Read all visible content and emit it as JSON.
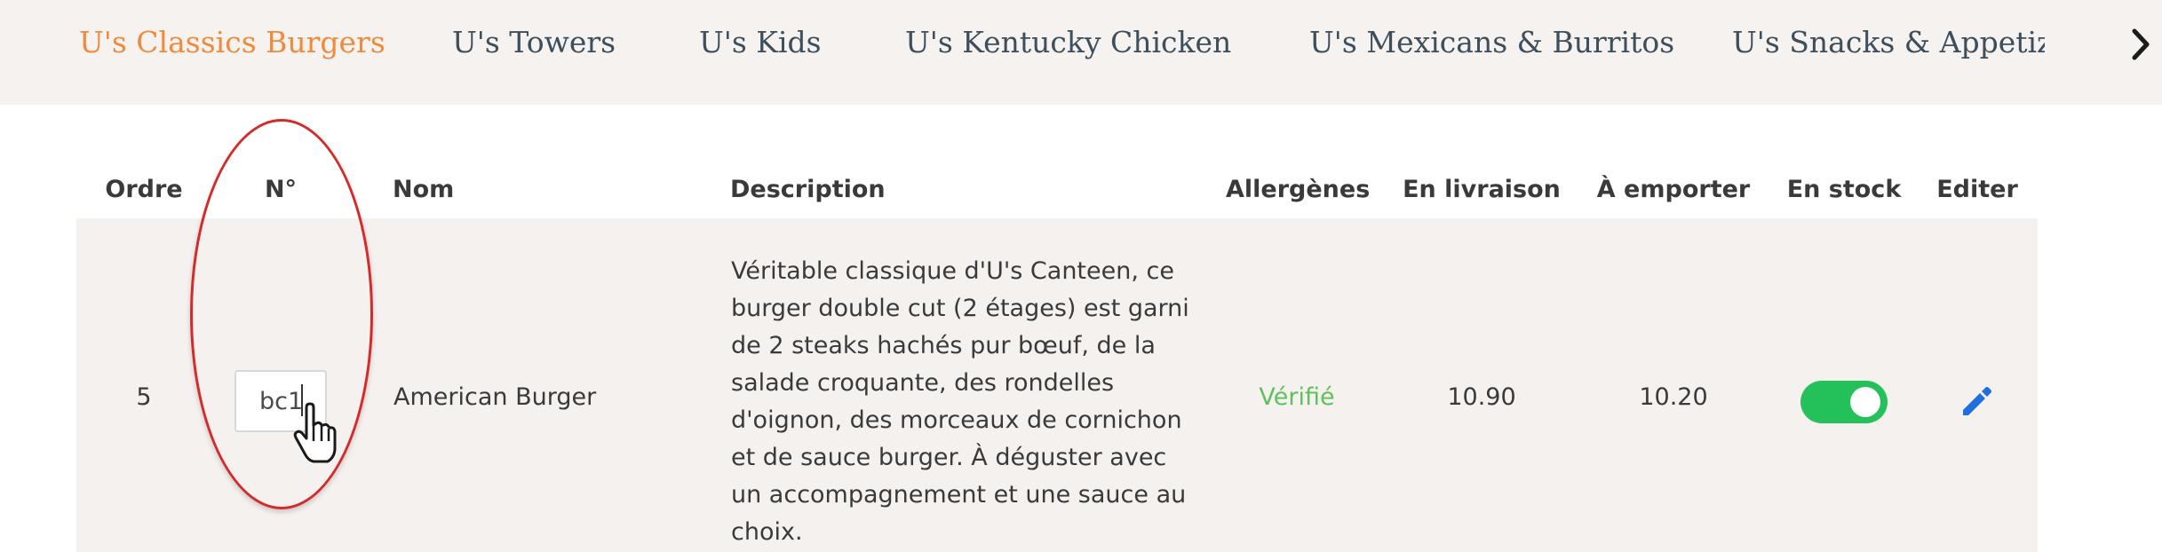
{
  "tabs": {
    "items": [
      {
        "label": "U's Classics Burgers",
        "active": true
      },
      {
        "label": "U's Towers",
        "active": false
      },
      {
        "label": "U's Kids",
        "active": false
      },
      {
        "label": "U's Kentucky Chicken",
        "active": false
      },
      {
        "label": "U's Mexicans & Burritos",
        "active": false
      },
      {
        "label": "U's Snacks & Appetizers",
        "active": false
      }
    ],
    "next_icon": "chevron-right-icon",
    "active_color": "#ee8b3d"
  },
  "table": {
    "headers": {
      "order": "Ordre",
      "number": "N°",
      "name": "Nom",
      "description": "Description",
      "allergens": "Allergènes",
      "delivery": "En livraison",
      "takeaway": "À emporter",
      "in_stock": "En stock",
      "edit": "Editer"
    },
    "rows": [
      {
        "order": "5",
        "number": "bc1",
        "name": "American Burger",
        "description": "Véritable classique d'U's Canteen, ce burger double cut (2 étages) est garni de 2 steaks hachés pur bœuf, de la salade croquante, des rondelles d'oignon, des morceaux de cornichon et de sauce burger. À déguster avec un accompagnement et une sauce au choix.",
        "allergens": "Vérifié",
        "delivery_price": "10.90",
        "takeaway_price": "10.20",
        "in_stock": true,
        "edit_icon": "pencil-icon"
      }
    ]
  },
  "colors": {
    "toggle_on": "#24c15b",
    "verified": "#5ec15e",
    "edit_icon": "#1f6fe0",
    "annotation": "#d42a2a"
  }
}
